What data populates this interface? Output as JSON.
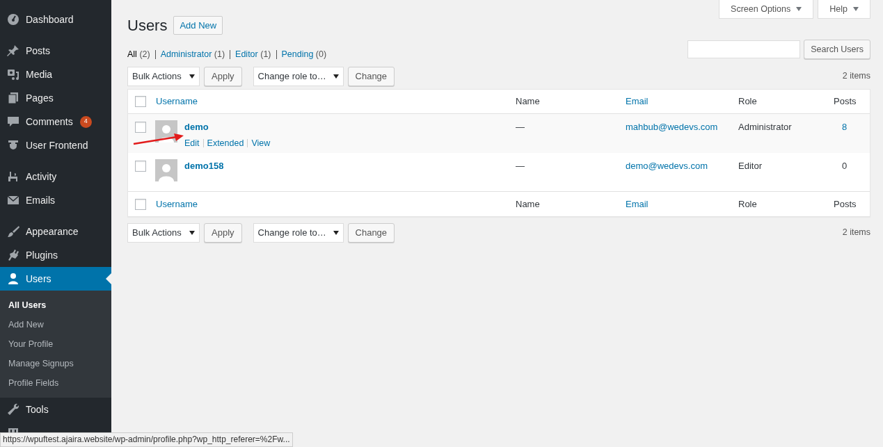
{
  "sidebar": {
    "groups": [
      [
        {
          "label": "Dashboard",
          "selected": false
        }
      ],
      [
        {
          "label": "Posts",
          "selected": false
        },
        {
          "label": "Media",
          "selected": false
        },
        {
          "label": "Pages",
          "selected": false
        },
        {
          "label": "Comments",
          "selected": false,
          "badge": "4"
        },
        {
          "label": "User Frontend",
          "selected": false
        }
      ],
      [
        {
          "label": "Activity",
          "selected": false
        },
        {
          "label": "Emails",
          "selected": false
        }
      ],
      [
        {
          "label": "Appearance",
          "selected": false
        },
        {
          "label": "Plugins",
          "selected": false
        },
        {
          "label": "Users",
          "selected": true,
          "submenu": [
            {
              "label": "All Users",
              "selected": true
            },
            {
              "label": "Add New",
              "selected": false
            },
            {
              "label": "Your Profile",
              "selected": false
            },
            {
              "label": "Manage Signups",
              "selected": false
            },
            {
              "label": "Profile Fields",
              "selected": false
            }
          ]
        },
        {
          "label": "Tools",
          "selected": false
        },
        {
          "selected": false
        }
      ]
    ]
  },
  "screen_tabs": [
    "Screen Options",
    "Help"
  ],
  "title": "Users",
  "add_new": "Add New",
  "filters": [
    {
      "label": "All",
      "count": "(2)",
      "selected": true
    },
    {
      "label": "Administrator",
      "count": "(1)",
      "selected": false
    },
    {
      "label": "Editor",
      "count": "(1)",
      "selected": false
    },
    {
      "label": "Pending",
      "count": "(0)",
      "selected": false
    }
  ],
  "search_button": "Search Users",
  "tablenav_top": {
    "bulk": "Bulk Actions",
    "apply": "Apply",
    "role": "Change role to…",
    "change": "Change",
    "count": "2 items"
  },
  "tablenav_bottom": {
    "bulk": "Bulk Actions",
    "apply": "Apply",
    "role": "Change role to…",
    "change": "Change",
    "count": "2 items"
  },
  "table": {
    "header_checked": false,
    "footer_checked": false,
    "columns": [
      {
        "label": "Username",
        "sortable": true
      },
      {
        "label": "Name",
        "sortable": false
      },
      {
        "label": "Email",
        "sortable": true
      },
      {
        "label": "Role",
        "sortable": false
      },
      {
        "label": "Posts",
        "sortable": false
      }
    ],
    "rows": [
      {
        "checked": false,
        "username": "demo",
        "name": "—",
        "email": "mahbub@wedevs.com",
        "role": "Administrator",
        "posts": "8",
        "posts_linked": true,
        "actions": [
          "Edit",
          "Extended",
          "View"
        ]
      },
      {
        "checked": false,
        "username": "demo158",
        "name": "—",
        "email": "demo@wedevs.com",
        "role": "Editor",
        "posts": "0",
        "posts_linked": false
      }
    ],
    "footer_columns": [
      {
        "label": "Username",
        "sortable": true
      },
      {
        "label": "Name",
        "sortable": false
      },
      {
        "label": "Email",
        "sortable": true
      },
      {
        "label": "Role",
        "sortable": false
      },
      {
        "label": "Posts",
        "sortable": false
      }
    ]
  },
  "status_bar": "https://wpuftest.ajaira.website/wp-admin/profile.php?wp_http_referer=%2Fw..."
}
